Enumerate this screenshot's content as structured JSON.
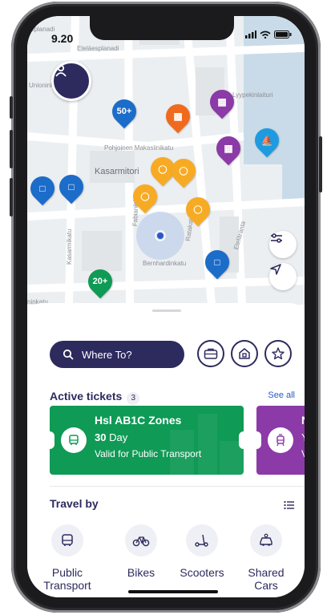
{
  "status": {
    "time": "9.20"
  },
  "map": {
    "streets": [
      "Eteläesplanadi",
      "Lyypekinlaituri",
      "Pohjoinen Makasiinikatu",
      "Kasarmitori",
      "Bernhardinkatu",
      "Kasarmikatu",
      "Fabianinkatu",
      "Ratakatu",
      "Eteläranta",
      "esplanadi",
      "Unioninkatu",
      "ninkatu"
    ],
    "clusters": [
      "50+",
      "20+"
    ]
  },
  "search": {
    "placeholder": "Where To?"
  },
  "tickets": {
    "title": "Active tickets",
    "count": "3",
    "see_all": "See all",
    "items": [
      {
        "title": "Hsl AB1C Zones",
        "duration_num": "30",
        "duration_unit": "Day",
        "subtitle": "Valid for Public Transport",
        "color": "#0f9a55"
      },
      {
        "title": "Nr",
        "line2": "Yo",
        "line3": "Va",
        "color": "#8b3aa7"
      }
    ]
  },
  "travel": {
    "title": "Travel by",
    "items": [
      {
        "label": "Public Transport",
        "icon": "bus-icon"
      },
      {
        "label": "Bikes",
        "icon": "bike-icon"
      },
      {
        "label": "Scooters",
        "icon": "scooter-icon"
      },
      {
        "label": "Shared Cars",
        "icon": "car-icon"
      }
    ]
  },
  "colors": {
    "navy": "#2d2a5e",
    "green": "#0f9a55",
    "purple": "#8b3aa7",
    "orange": "#f06a1e",
    "yellow": "#f7ab24",
    "blue": "#1c6cc9"
  }
}
